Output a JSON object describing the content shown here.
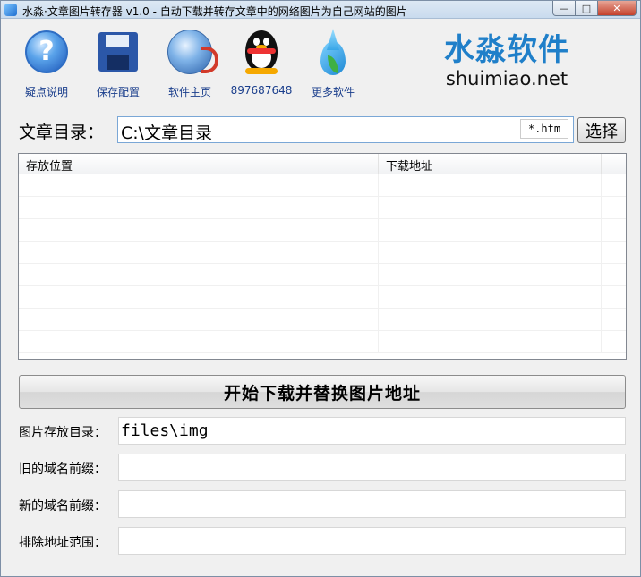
{
  "window": {
    "title": "水淼·文章图片转存器 v1.0 - 自动下载并转存文章中的网络图片为自己网站的图片",
    "minimize": "—",
    "maximize": "□",
    "close": "✕"
  },
  "toolbar": {
    "items": [
      {
        "label": "疑点说明",
        "icon": "help-icon"
      },
      {
        "label": "保存配置",
        "icon": "floppy-disk-icon"
      },
      {
        "label": "软件主页",
        "icon": "globe-icon"
      },
      {
        "label": "897687648",
        "icon": "qq-penguin-icon"
      },
      {
        "label": "更多软件",
        "icon": "water-drop-icon"
      }
    ]
  },
  "brand": {
    "name_cn": "水淼软件",
    "domain": "shuimiao.net"
  },
  "article_dir": {
    "label": "文章目录：",
    "value": "C:\\文章目录",
    "extension": "*.htm",
    "choose_button": "选择"
  },
  "grid": {
    "columns": [
      "存放位置",
      "下载地址",
      ""
    ],
    "rows": 8
  },
  "start_button": "开始下载并替换图片地址",
  "fields": [
    {
      "label": "图片存放目录：",
      "value": "files\\img"
    },
    {
      "label": "旧的域名前缀：",
      "value": ""
    },
    {
      "label": "新的域名前缀：",
      "value": ""
    },
    {
      "label": "排除地址范围：",
      "value": ""
    }
  ],
  "colors": {
    "brand_blue": "#1f7fc9",
    "link_blue": "#1a3e8c",
    "window_bg": "#f0f0f0"
  }
}
